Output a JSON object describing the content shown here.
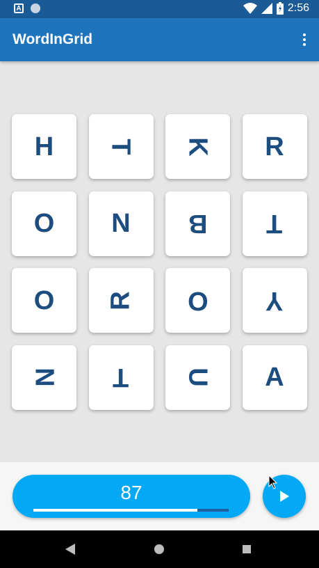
{
  "status_bar": {
    "time": "2:56",
    "left_icons": [
      "app-notification-icon",
      "circle-notification-icon"
    ],
    "right_icons": [
      "wifi-icon",
      "signal-icon",
      "battery-icon"
    ]
  },
  "app_bar": {
    "title": "WordInGrid",
    "menu_icon": "more-vert-icon"
  },
  "grid": {
    "tiles": [
      {
        "letter": "H",
        "rotation": 0
      },
      {
        "letter": "T",
        "rotation": 90
      },
      {
        "letter": "K",
        "rotation": 90
      },
      {
        "letter": "R",
        "rotation": 0
      },
      {
        "letter": "O",
        "rotation": 0
      },
      {
        "letter": "N",
        "rotation": 0
      },
      {
        "letter": "B",
        "rotation": 180
      },
      {
        "letter": "T",
        "rotation": 180
      },
      {
        "letter": "O",
        "rotation": 0
      },
      {
        "letter": "R",
        "rotation": 270
      },
      {
        "letter": "O",
        "rotation": 180
      },
      {
        "letter": "Y",
        "rotation": 180
      },
      {
        "letter": "N",
        "rotation": 90
      },
      {
        "letter": "T",
        "rotation": 180
      },
      {
        "letter": "U",
        "rotation": 90
      },
      {
        "letter": "A",
        "rotation": 0
      }
    ]
  },
  "score": {
    "value": "87",
    "progress": 0.84
  },
  "play_button": {
    "icon": "play-icon"
  },
  "nav_bar": {
    "icons": [
      "back-icon",
      "home-icon",
      "recents-icon"
    ]
  },
  "colors": {
    "status_bar": "#1a5a96",
    "app_bar": "#1f74bc",
    "accent": "#03a9f4",
    "tile_text": "#1d4c7f"
  }
}
